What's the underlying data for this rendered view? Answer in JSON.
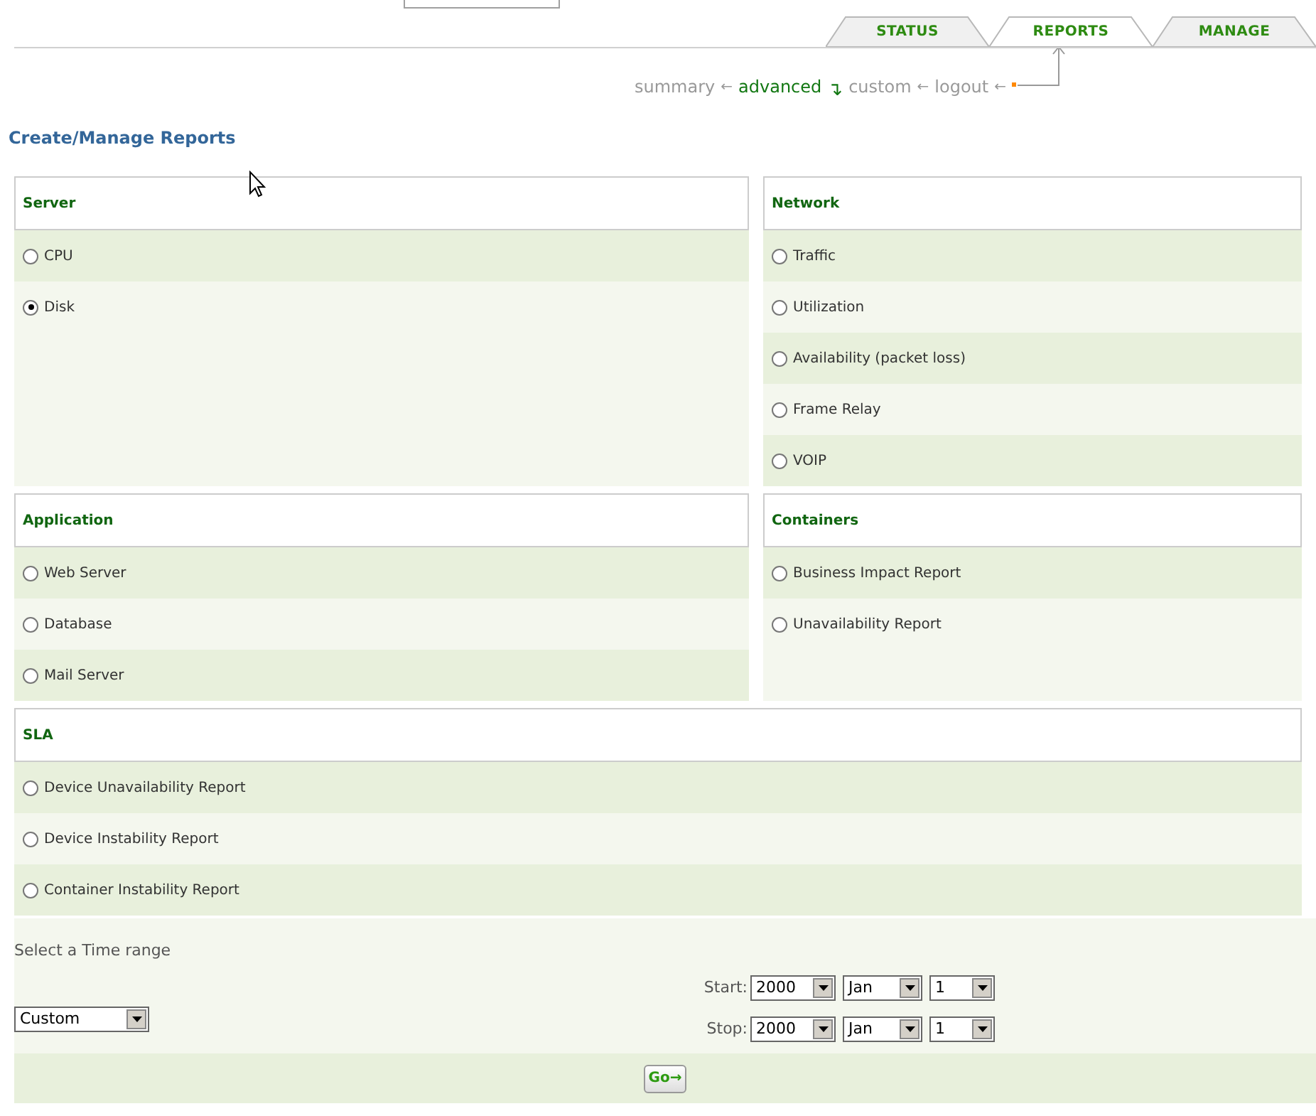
{
  "tabs": [
    {
      "label": "STATUS",
      "selected": false
    },
    {
      "label": "REPORTS",
      "selected": true
    },
    {
      "label": "MANAGE",
      "selected": false
    }
  ],
  "nav": [
    {
      "label": "summary",
      "selected": false,
      "arrow": "←"
    },
    {
      "label": "advanced",
      "selected": true,
      "arrow": "↴"
    },
    {
      "label": "custom",
      "selected": false,
      "arrow": "←"
    },
    {
      "label": "logout",
      "selected": false,
      "arrow": "←"
    }
  ],
  "page_title": "Create/Manage Reports",
  "sections": [
    {
      "title": "Server",
      "kind": "half",
      "options": [
        {
          "label": "CPU",
          "selected": false
        },
        {
          "label": "Disk",
          "selected": true
        }
      ]
    },
    {
      "title": "Network",
      "kind": "half",
      "options": [
        {
          "label": "Traffic",
          "selected": false
        },
        {
          "label": "Utilization",
          "selected": false
        },
        {
          "label": "Availability (packet loss)",
          "selected": false
        },
        {
          "label": "Frame Relay",
          "selected": false
        },
        {
          "label": "VOIP",
          "selected": false
        }
      ]
    },
    {
      "title": "Application",
      "kind": "half",
      "options": [
        {
          "label": "Web Server",
          "selected": false
        },
        {
          "label": "Database",
          "selected": false
        },
        {
          "label": "Mail Server",
          "selected": false
        }
      ]
    },
    {
      "title": "Containers",
      "kind": "half",
      "options": [
        {
          "label": "Business Impact Report",
          "selected": false
        },
        {
          "label": "Unavailability Report",
          "selected": false
        }
      ]
    },
    {
      "title": "SLA",
      "kind": "full",
      "options": [
        {
          "label": "Device Unavailability Report",
          "selected": false
        },
        {
          "label": "Device Instability Report",
          "selected": false
        },
        {
          "label": "Container Instability Report",
          "selected": false
        }
      ]
    }
  ],
  "time_range": {
    "label": "Select a Time range",
    "preset": "Custom",
    "dates": [
      {
        "label": "Start:",
        "year": "2000",
        "month": "Jan",
        "day": "1"
      },
      {
        "label": "Stop:",
        "year": "2000",
        "month": "Jan",
        "day": "1"
      }
    ],
    "go": "Go→"
  }
}
